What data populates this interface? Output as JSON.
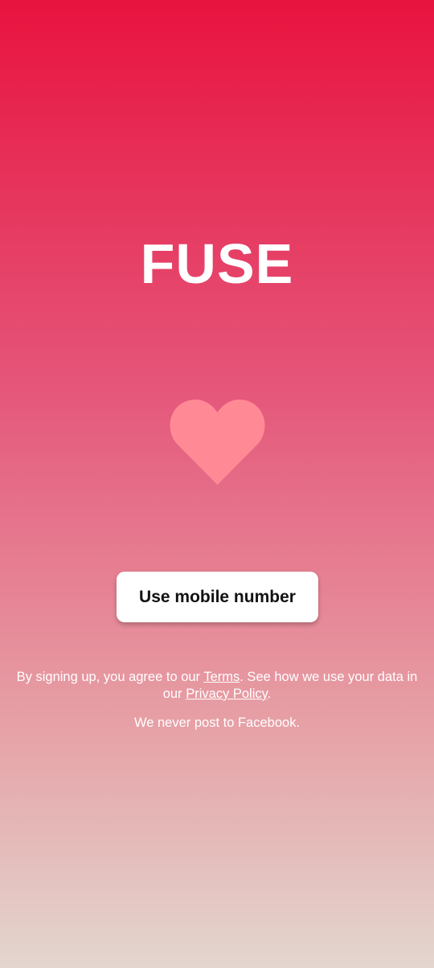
{
  "app": {
    "logo_text": "FUSE"
  },
  "colors": {
    "gradient_top": "#e8133f",
    "gradient_bottom": "#e3d6ce",
    "heart": "#ff8a95",
    "button_bg": "#ffffff"
  },
  "heart": {
    "icon": "heart-icon"
  },
  "cta": {
    "label": "Use mobile number"
  },
  "legal": {
    "prefix": "By signing up, you agree to our ",
    "terms_link": "Terms",
    "middle": ". See how we use your data in our ",
    "privacy_link": "Privacy Policy",
    "suffix": "."
  },
  "note": "We never post to Facebook."
}
